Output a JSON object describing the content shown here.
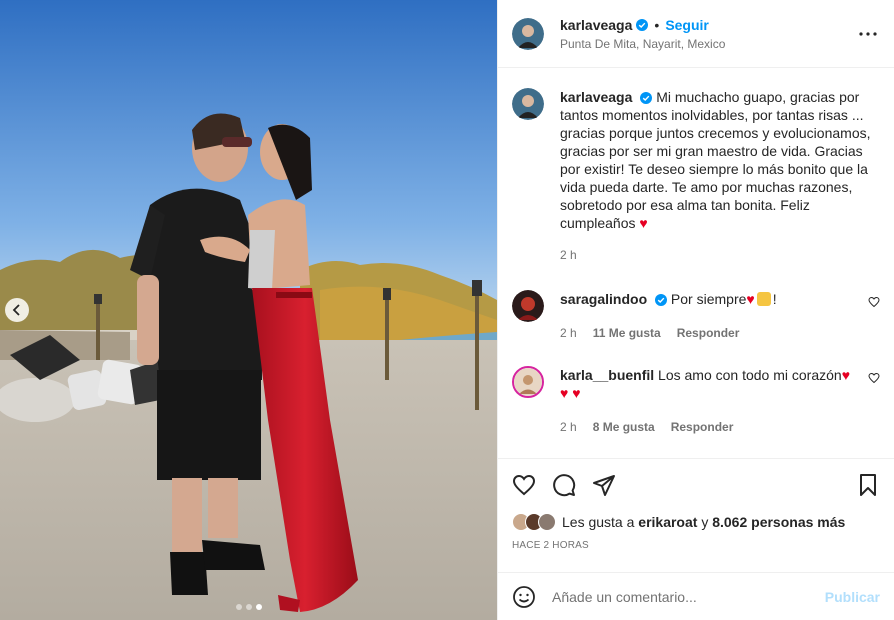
{
  "post": {
    "username": "karlaveaga",
    "follow_label": "Seguir",
    "separator": "•",
    "location": "Punta De Mita, Nayarit, Mexico",
    "caption": "Mi muchacho guapo, gracias por tantos momentos inolvidables, por tantas risas ... gracias porque juntos crecemos y evolucionamos, gracias por ser mi gran maestro de vida. Gracias por existir! Te deseo siempre lo más bonito que la vida pueda darte. Te amo por muchas razones, sobretodo por esa alma tan bonita. Feliz cumpleaños",
    "caption_emoji": "♥",
    "caption_time": "2 h",
    "carousel": {
      "total": 3,
      "active": 3
    }
  },
  "comments": [
    {
      "username": "saragalindoo",
      "text": "Por siempre",
      "emoji": "♥",
      "trailing": "!",
      "time": "2 h",
      "likes": "11 Me gusta",
      "reply_label": "Responder"
    },
    {
      "username": "karla__buenfil",
      "text": "Los amo con todo mi corazón",
      "emoji": "♥",
      "emoji_line2": "♥ ♥",
      "time": "2 h",
      "likes": "8 Me gusta",
      "reply_label": "Responder"
    }
  ],
  "likes": {
    "prefix": "Les gusta a",
    "user": "erikaroat",
    "connector": "y",
    "others": "8.062 personas más"
  },
  "time_ago": "HACE 2 HORAS",
  "comment_box": {
    "placeholder": "Añade un comentario...",
    "publish_label": "Publicar"
  },
  "colors": {
    "accent": "#0095f6",
    "heart": "#e60023",
    "publish_disabled": "#b2dffc"
  }
}
